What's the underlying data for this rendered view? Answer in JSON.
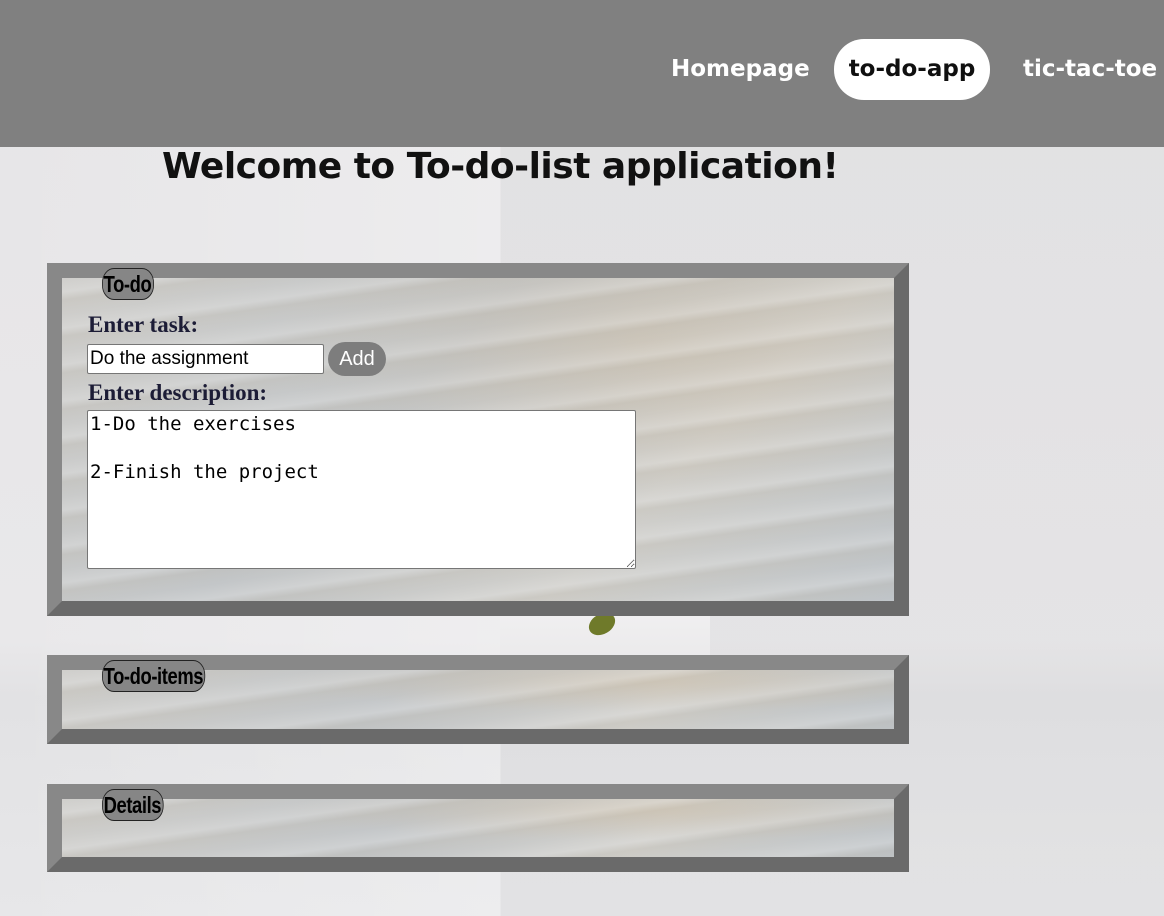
{
  "nav": {
    "items": [
      {
        "label": "Homepage",
        "active": false
      },
      {
        "label": "to-do-app",
        "active": true
      },
      {
        "label": "tic-tac-toe",
        "active": false
      }
    ]
  },
  "page": {
    "title": "Welcome to To-do-list application!"
  },
  "todo_panel": {
    "legend": "To-do",
    "task_label": "Enter task:",
    "task_value": "Do the assignment",
    "add_label": "Add",
    "description_label": "Enter description:",
    "description_value": "1-Do the exercises\n\n2-Finish the project"
  },
  "items_panel": {
    "legend": "To-do-items"
  },
  "details_panel": {
    "legend": "Details"
  },
  "colors": {
    "navbar": "#808080",
    "active_tab_bg": "#ffffff",
    "panel_border": "#6a6a6a",
    "button_bg": "#7d7d7d"
  }
}
